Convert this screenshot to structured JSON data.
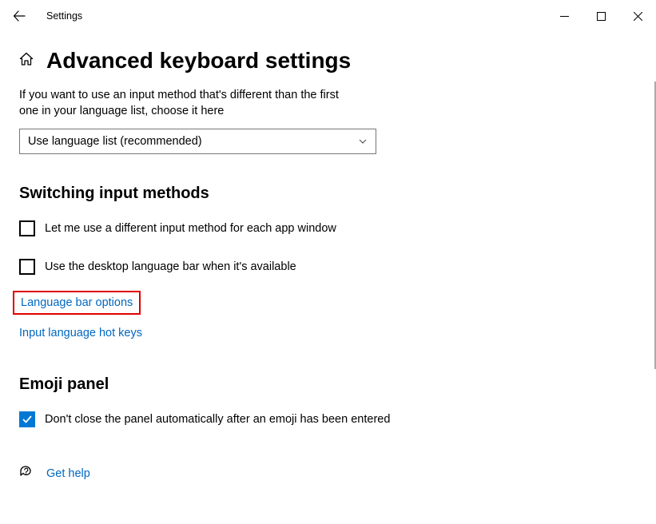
{
  "titlebar": {
    "title": "Settings"
  },
  "page": {
    "title": "Advanced keyboard settings"
  },
  "description": "If you want to use an input method that's different than the first one in your language list, choose it here",
  "dropdown": {
    "selected": "Use language list (recommended)"
  },
  "sections": {
    "switching": {
      "title": "Switching input methods",
      "checkbox1": {
        "label": "Let me use a different input method for each app window",
        "checked": false
      },
      "checkbox2": {
        "label": "Use the desktop language bar when it's available",
        "checked": false
      },
      "link1": "Language bar options",
      "link2": "Input language hot keys"
    },
    "emoji": {
      "title": "Emoji panel",
      "checkbox1": {
        "label": "Don't close the panel automatically after an emoji has been entered",
        "checked": true
      }
    }
  },
  "help": {
    "label": "Get help"
  }
}
